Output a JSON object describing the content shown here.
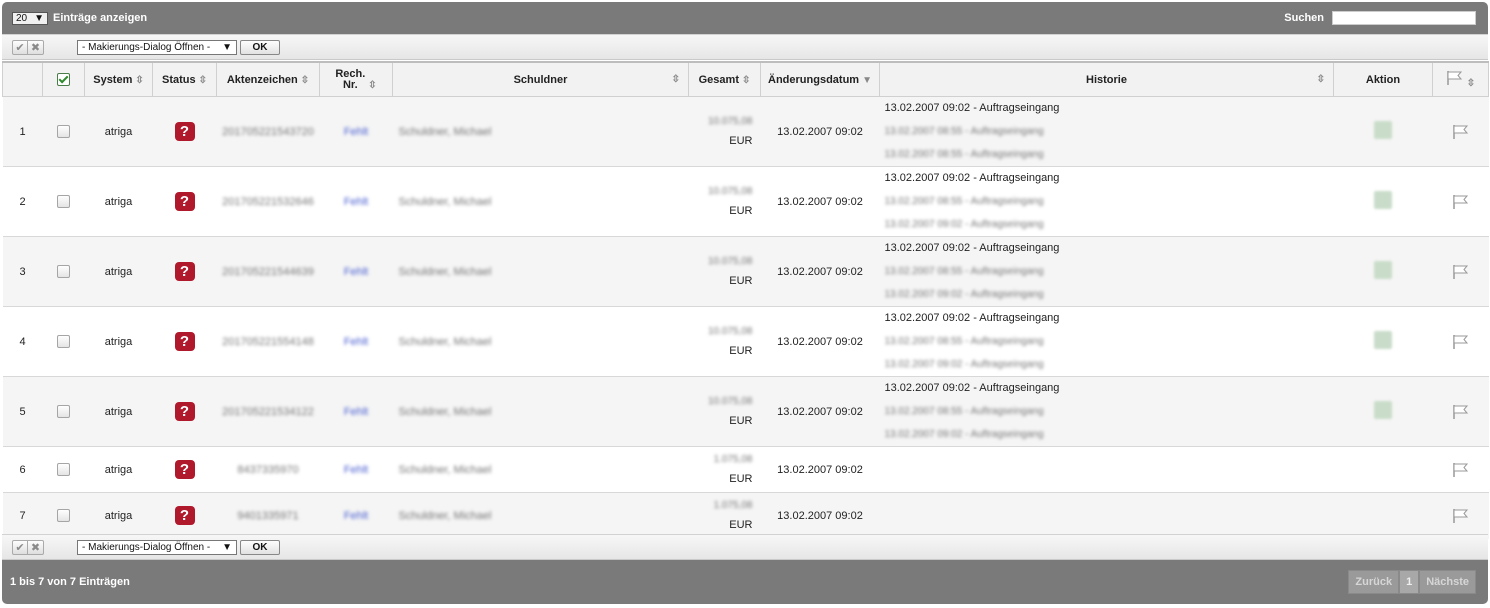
{
  "top": {
    "length_value": "20",
    "length_label": "Einträge anzeigen",
    "search_label": "Suchen",
    "search_value": ""
  },
  "actions": {
    "mark_dialog": "- Makierungs-Dialog Öffnen -",
    "ok": "OK",
    "check_all_icon": "checkmark-icon",
    "uncheck_all_icon": "cross-icon"
  },
  "columns": {
    "system": "System",
    "status": "Status",
    "aktenzeichen": "Aktenzeichen",
    "rech_nr": "Rech. Nr.",
    "schuldner": "Schuldner",
    "gesamt": "Gesamt",
    "aenderungsdatum": "Änderungsdatum",
    "historie": "Historie",
    "aktion": "Aktion"
  },
  "rows": [
    {
      "num": "1",
      "system": "atriga",
      "status": "?",
      "aktenzeichen": "201705221543720",
      "rech_nr": "Fehlt",
      "schuldner": "Schuldner, Michael",
      "gesamt_amount": "10.075,08",
      "currency": "EUR",
      "date": "13.02.2007 09:02",
      "history": [
        "13.02.2007 09:02 - Auftragseingang",
        "13.02.2007 08:55 - Auftragseingang",
        "13.02.2007 08:55 - Auftragseingang"
      ],
      "has_action": true
    },
    {
      "num": "2",
      "system": "atriga",
      "status": "?",
      "aktenzeichen": "201705221532646",
      "rech_nr": "Fehlt",
      "schuldner": "Schuldner, Michael",
      "gesamt_amount": "10.075,08",
      "currency": "EUR",
      "date": "13.02.2007 09:02",
      "history": [
        "13.02.2007 09:02 - Auftragseingang",
        "13.02.2007 08:55 - Auftragseingang",
        "13.02.2007 09:02 - Auftragseingang"
      ],
      "has_action": true
    },
    {
      "num": "3",
      "system": "atriga",
      "status": "?",
      "aktenzeichen": "201705221544639",
      "rech_nr": "Fehlt",
      "schuldner": "Schuldner, Michael",
      "gesamt_amount": "10.075,08",
      "currency": "EUR",
      "date": "13.02.2007 09:02",
      "history": [
        "13.02.2007 09:02 - Auftragseingang",
        "13.02.2007 08:55 - Auftragseingang",
        "13.02.2007 09:02 - Auftragseingang"
      ],
      "has_action": true
    },
    {
      "num": "4",
      "system": "atriga",
      "status": "?",
      "aktenzeichen": "201705221554148",
      "rech_nr": "Fehlt",
      "schuldner": "Schuldner, Michael",
      "gesamt_amount": "10.075,08",
      "currency": "EUR",
      "date": "13.02.2007 09:02",
      "history": [
        "13.02.2007 09:02 - Auftragseingang",
        "13.02.2007 08:55 - Auftragseingang",
        "13.02.2007 09:02 - Auftragseingang"
      ],
      "has_action": true
    },
    {
      "num": "5",
      "system": "atriga",
      "status": "?",
      "aktenzeichen": "201705221534122",
      "rech_nr": "Fehlt",
      "schuldner": "Schuldner, Michael",
      "gesamt_amount": "10.075,08",
      "currency": "EUR",
      "date": "13.02.2007 09:02",
      "history": [
        "13.02.2007 09:02 - Auftragseingang",
        "13.02.2007 08:55 - Auftragseingang",
        "13.02.2007 09:02 - Auftragseingang"
      ],
      "has_action": true
    },
    {
      "num": "6",
      "system": "atriga",
      "status": "?",
      "aktenzeichen": "8437335970",
      "rech_nr": "Fehlt",
      "schuldner": "Schuldner, Michael",
      "gesamt_amount": "1.075,08",
      "currency": "EUR",
      "date": "13.02.2007 09:02",
      "history": [],
      "has_action": false
    },
    {
      "num": "7",
      "system": "atriga",
      "status": "?",
      "aktenzeichen": "9401335971",
      "rech_nr": "Fehlt",
      "schuldner": "Schuldner, Michael",
      "gesamt_amount": "1.075,08",
      "currency": "EUR",
      "date": "13.02.2007 09:02",
      "history": [],
      "has_action": false
    }
  ],
  "footer": {
    "info": "1 bis 7 von 7 Einträgen",
    "prev": "Zurück",
    "page": "1",
    "next": "Nächste"
  }
}
